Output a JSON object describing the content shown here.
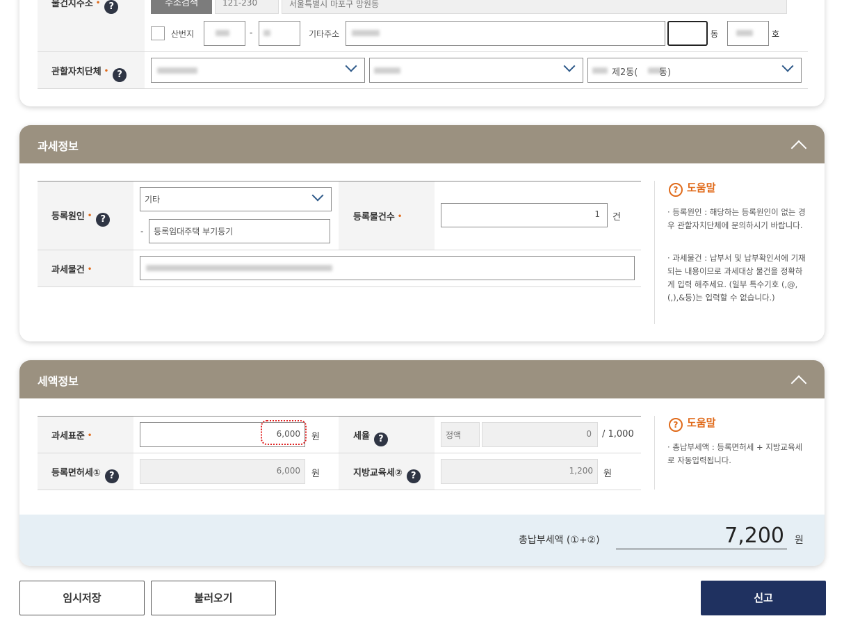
{
  "address": {
    "label": "물건지주소",
    "search_button": "주소검색",
    "zip": "121-230",
    "road_address": "서울특별시 마포구 망원동",
    "mountain_label": "산번지",
    "dash": "-",
    "other_address_label": "기타주소",
    "dong_unit": "동",
    "ho_unit": "호"
  },
  "jurisdiction": {
    "label": "관할자치단체",
    "select3_value": "제2동(",
    "select3_suffix": "동)"
  },
  "tax_info": {
    "title": "과세정보",
    "reg_cause_label": "등록원인",
    "reg_cause_value": "기타",
    "reg_cause_dash": "-",
    "reg_cause_detail": "등록임대주택 부기등기",
    "item_count_label": "등록물건수",
    "item_count_value": "1",
    "item_count_unit": "건",
    "tax_object_label": "과세물건",
    "help": {
      "title": "도움말",
      "text1": "· 등록원인 : 해당하는 등록원인이 없는 경우 관할자치단체에 문의하시기 바랍니다.",
      "text2": "· 과세물건 : 납부서 및 납부확인서에 기재되는 내용이므로 과세대상 물건을 정확하게 입력 해주세요. (일부 특수기호 (,@,(,),&등)는 입력할 수 없습니다.)"
    }
  },
  "tax_amount": {
    "title": "세액정보",
    "base_label": "과세표준",
    "base_value": "6,000",
    "base_unit": "원",
    "rate_label": "세율",
    "rate_type": "정액",
    "rate_value": "0",
    "rate_unit": "/ 1,000",
    "license_tax_label": "등록면허세①",
    "license_tax_value": "6,000",
    "license_tax_unit": "원",
    "edu_tax_label": "지방교육세②",
    "edu_tax_value": "1,200",
    "edu_tax_unit": "원",
    "help": {
      "title": "도움말",
      "text1": "· 총납부세액 : 등록면허세 + 지방교육세로 자동입력됩니다."
    },
    "total_label": "총납부세액 (①+②)",
    "total_value": "7,200",
    "total_unit": "원"
  },
  "buttons": {
    "temp_save": "임시저장",
    "load": "불러오기",
    "submit": "신고"
  },
  "colors": {
    "header": "#9b9180",
    "primary": "#1f3160",
    "accent": "#e06a1a",
    "total_bg": "#e6eff5"
  }
}
